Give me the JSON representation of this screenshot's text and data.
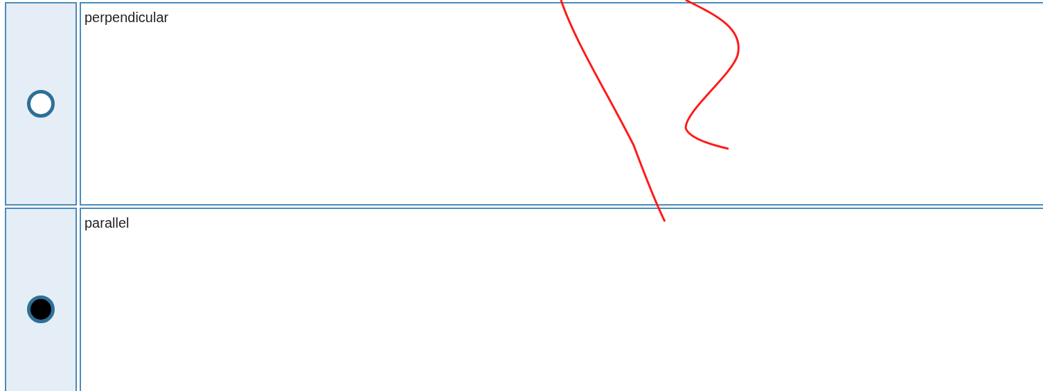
{
  "options": [
    {
      "label": "perpendicular",
      "selected": false
    },
    {
      "label": "parallel",
      "selected": true
    }
  ]
}
